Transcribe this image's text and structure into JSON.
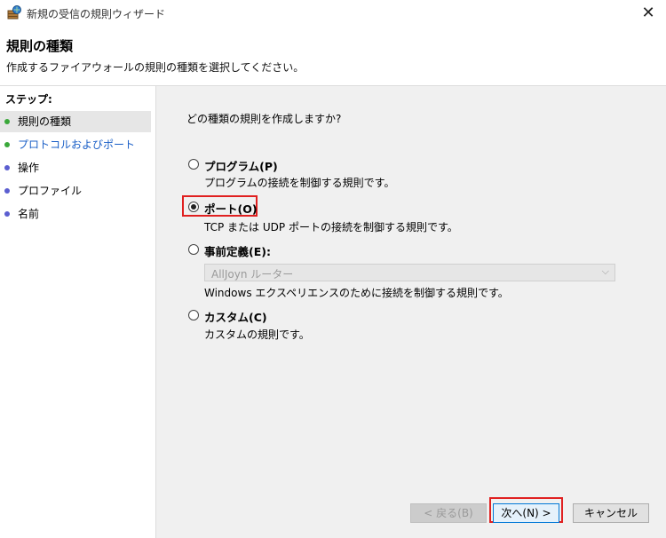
{
  "window": {
    "title": "新規の受信の規則ウィザード",
    "close_glyph": "✕"
  },
  "header": {
    "title": "規則の種類",
    "subtitle": "作成するファイアウォールの規則の種類を選択してください。"
  },
  "steps": {
    "title": "ステップ:",
    "items": [
      {
        "label": "規則の種類",
        "state": "current"
      },
      {
        "label": "プロトコルおよびポート",
        "state": "link"
      },
      {
        "label": "操作",
        "state": "pending"
      },
      {
        "label": "プロファイル",
        "state": "pending"
      },
      {
        "label": "名前",
        "state": "pending"
      }
    ]
  },
  "main": {
    "question": "どの種類の規則を作成しますか?",
    "options": [
      {
        "label": "プログラム(P)",
        "desc": "プログラムの接続を制御する規則です。",
        "checked": false
      },
      {
        "label": "ポート(O)",
        "desc": "TCP または UDP ポートの接続を制御する規則です。",
        "checked": true
      },
      {
        "label": "事前定義(E):",
        "desc": "Windows エクスペリエンスのために接続を制御する規則です。",
        "checked": false
      },
      {
        "label": "カスタム(C)",
        "desc": "カスタムの規則です。",
        "checked": false
      }
    ],
    "predefined_select": {
      "value": "AllJoyn ルーター"
    }
  },
  "buttons": {
    "back": "< 戻る(B)",
    "next": "次へ(N) >",
    "cancel": "キャンセル"
  },
  "colors": {
    "highlight": "#e02020",
    "step_done": "#3aa83a",
    "step_pending": "#5b5ed0",
    "link": "#1a5fc7"
  }
}
